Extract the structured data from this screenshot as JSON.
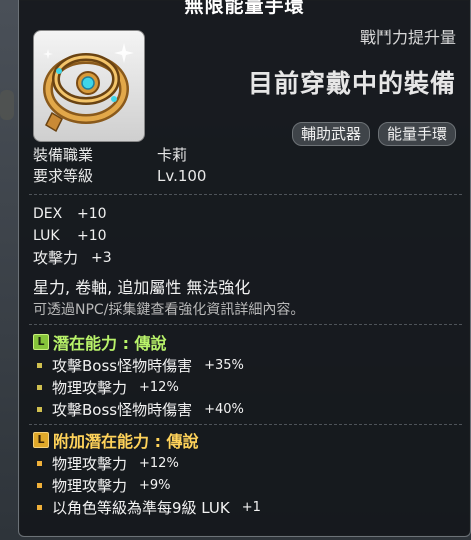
{
  "item": {
    "name": "無限能量手環",
    "combat_power_label": "戰鬥力提升量",
    "equipped_label": "目前穿戴中的裝備",
    "tags": [
      "輔助武器",
      "能量手環"
    ],
    "icon": "energy-bracelet-icon"
  },
  "requirements": [
    {
      "key": "裝備職業",
      "value": "卡莉"
    },
    {
      "key": "要求等級",
      "value": "Lv.100"
    }
  ],
  "stats": [
    {
      "key": "DEX",
      "value": "+10"
    },
    {
      "key": "LUK",
      "value": "+10"
    },
    {
      "key": "攻擊力",
      "value": "+3"
    }
  ],
  "upgrades": {
    "text": "星力, 卷軸, 追加屬性 無法強化",
    "note": "可透過NPC/採集鍵查看強化資訊詳細內容。"
  },
  "potential": {
    "title": "潛在能力 : 傳說",
    "badge": "L",
    "lines": [
      {
        "label": "攻擊Boss怪物時傷害",
        "value": "+35%"
      },
      {
        "label": "物理攻擊力",
        "value": "+12%"
      },
      {
        "label": "攻擊Boss怪物時傷害",
        "value": "+40%"
      }
    ]
  },
  "bonus_potential": {
    "title": "附加潛在能力 : 傳說",
    "badge": "L",
    "lines": [
      {
        "label": "物理攻擊力",
        "value": "+12%"
      },
      {
        "label": "物理攻擊力",
        "value": "+9%"
      },
      {
        "label": "以角色等級為準每9級 LUK",
        "value": "+1"
      }
    ]
  },
  "colors": {
    "potential_title": "#b9f36a",
    "bonus_title": "#ffd35a",
    "tooltip_bg": "#14181c"
  }
}
